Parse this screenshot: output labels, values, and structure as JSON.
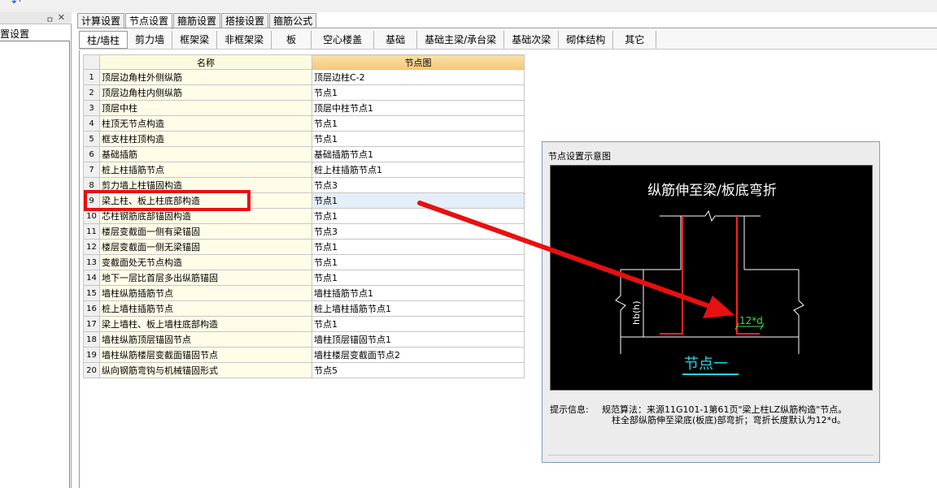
{
  "left_panel": {
    "pin_icon": "pin-icon",
    "close_icon": "close-icon",
    "tree_item": "置设置"
  },
  "main_tabs": [
    {
      "label": "计算设置"
    },
    {
      "label": "节点设置"
    },
    {
      "label": "箍筋设置"
    },
    {
      "label": "搭接设置"
    },
    {
      "label": "箍筋公式"
    }
  ],
  "sub_tabs": [
    {
      "label": "柱/墙柱"
    },
    {
      "label": "剪力墙"
    },
    {
      "label": "框架梁"
    },
    {
      "label": "非框架梁"
    },
    {
      "label": "板"
    },
    {
      "label": "空心楼盖"
    },
    {
      "label": "基础"
    },
    {
      "label": "基础主梁/承台梁"
    },
    {
      "label": "基础次梁"
    },
    {
      "label": "砌体结构"
    },
    {
      "label": "其它"
    }
  ],
  "table": {
    "headers": {
      "name": "名称",
      "node": "节点图"
    },
    "rows": [
      {
        "idx": "1",
        "name": "顶层边角柱外侧纵筋",
        "node": "顶层边柱C-2"
      },
      {
        "idx": "2",
        "name": "顶层边角柱内侧纵筋",
        "node": "节点1"
      },
      {
        "idx": "3",
        "name": "顶层中柱",
        "node": "顶层中柱节点1"
      },
      {
        "idx": "4",
        "name": "柱顶无节点构造",
        "node": "节点1"
      },
      {
        "idx": "5",
        "name": "框支柱柱顶构造",
        "node": "节点1"
      },
      {
        "idx": "6",
        "name": "基础插筋",
        "node": "基础插筋节点1"
      },
      {
        "idx": "7",
        "name": "桩上柱插筋节点",
        "node": "桩上柱插筋节点1"
      },
      {
        "idx": "8",
        "name": "剪力墙上柱锚固构造",
        "node": "节点3"
      },
      {
        "idx": "9",
        "name": "梁上柱、板上柱底部构造",
        "node": "节点1"
      },
      {
        "idx": "10",
        "name": "芯柱钢筋底部锚固构造",
        "node": "节点1"
      },
      {
        "idx": "11",
        "name": "楼层变截面一侧有梁锚固",
        "node": "节点3"
      },
      {
        "idx": "12",
        "name": "楼层变截面一侧无梁锚固",
        "node": "节点1"
      },
      {
        "idx": "13",
        "name": "变截面处无节点构造",
        "node": "节点1"
      },
      {
        "idx": "14",
        "name": "地下一层比首层多出纵筋锚固",
        "node": "节点1"
      },
      {
        "idx": "15",
        "name": "墙柱纵筋插筋节点",
        "node": "墙柱插筋节点1"
      },
      {
        "idx": "16",
        "name": "桩上墙柱插筋节点",
        "node": "桩上墙柱插筋节点1"
      },
      {
        "idx": "17",
        "name": "梁上墙柱、板上墙柱底部构造",
        "node": "节点1"
      },
      {
        "idx": "18",
        "name": "墙柱纵筋顶层锚固节点",
        "node": "墙柱顶层锚固节点1"
      },
      {
        "idx": "19",
        "name": "墙柱纵筋楼层变截面锚固节点",
        "node": "墙柱楼层变截面节点2"
      },
      {
        "idx": "20",
        "name": "纵向钢筋弯钩与机械锚固形式",
        "node": "节点5"
      }
    ]
  },
  "diagram": {
    "panel_title": "节点设置示意图",
    "heading": "纵筋伸至梁/板底弯折",
    "dim_label": "hb(h)",
    "bend_label": "12*d",
    "node_label": "节点一",
    "colors": {
      "rebar": "#ff2020",
      "lines": "#ffffff",
      "label": "#22d6f0",
      "dim": "#3ce03c",
      "arrow": "#e81010"
    }
  },
  "hint": {
    "label": "提示信息:",
    "line1": "规范算法：来源11G101-1第61页\"梁上柱LZ纵筋构造\"节点。",
    "line2": "柱全部纵筋伸至梁底(板底)部弯折；弯折长度默认为12*d。"
  }
}
